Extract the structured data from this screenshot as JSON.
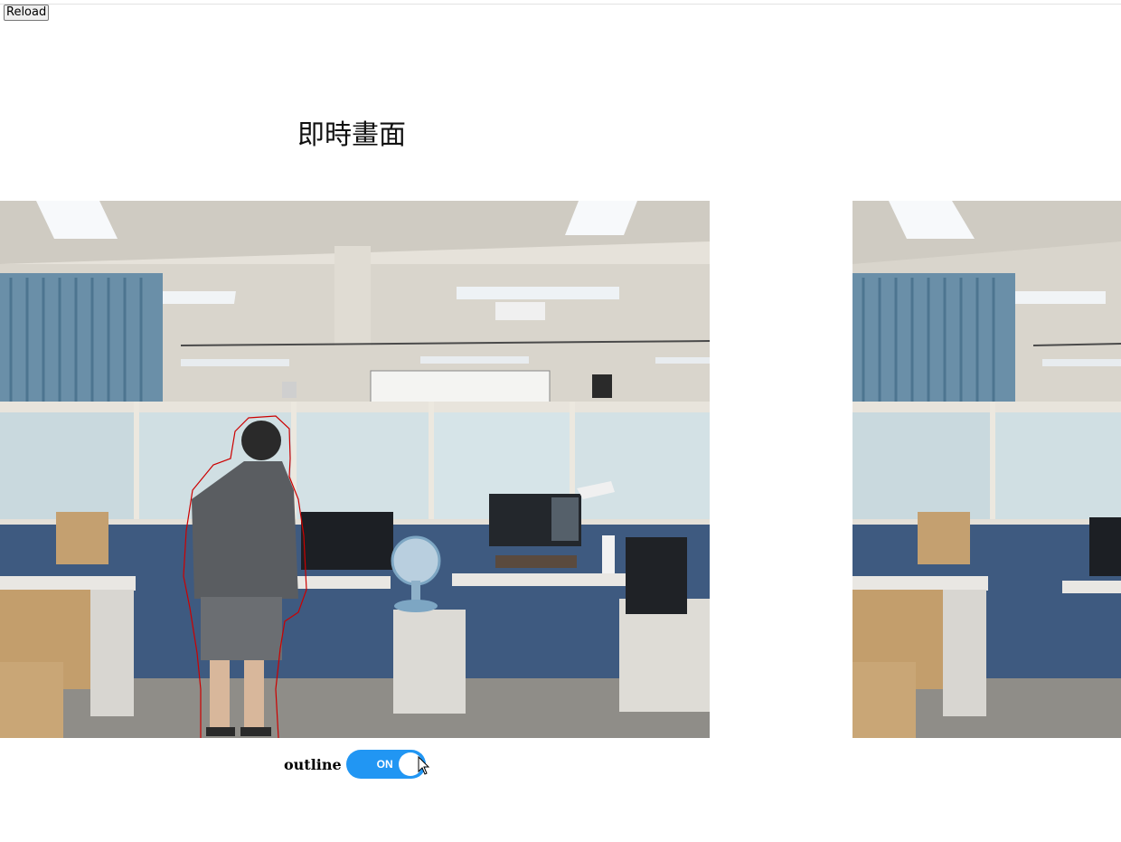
{
  "toolbar": {
    "reload_label": "Reload"
  },
  "page": {
    "title": "即時畫面"
  },
  "controls": {
    "outline_label": "outline",
    "outline_toggle": {
      "state_text": "ON",
      "on": true,
      "accent_color": "#2196f3"
    }
  },
  "feeds": [
    {
      "name": "live-camera-feed",
      "person_outline": true,
      "outline_color": "#cc0000"
    },
    {
      "name": "second-camera-feed"
    }
  ]
}
